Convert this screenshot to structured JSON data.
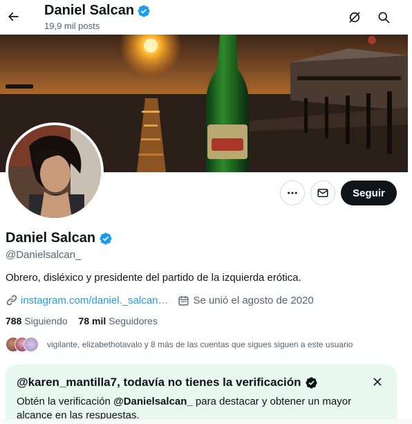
{
  "header": {
    "display_name": "Daniel Salcan",
    "posts_count": "19,9 mil posts"
  },
  "profile": {
    "display_name": "Daniel Salcan",
    "handle": "@Danielsalcan_",
    "bio": "Obrero, disléxico y presidente del partido de la izquierda erótica.",
    "link": "instagram.com/daniel._salcan…",
    "joined": "Se unió el agosto de 2020",
    "following_count": "788",
    "following_label": "Siguiendo",
    "followers_count": "78 mil",
    "followers_label": "Seguidores",
    "followers_you_know": "vigilante, elizabethotavalo y 8 más de las cuentas que sigues siguen a este usuario"
  },
  "actions": {
    "follow_label": "Seguir"
  },
  "verification_card": {
    "title": "@karen_mantilla7, todavía no tienes la verificación",
    "body_prefix": "Obtén la verificación ",
    "body_handle": "@Danielsalcan_",
    "body_suffix": " para destacar y obtener un mayor alcance en las respuestas."
  },
  "colors": {
    "accent": "#1d9bf0",
    "verified_badge": "#1d9bf0",
    "follow_button": "#0f1419",
    "card_background": "#e8f7ef",
    "secondary_text": "#536471"
  },
  "icons": {
    "back": "arrow-left-icon",
    "grok": "grok-icon",
    "search": "search-icon",
    "verified": "verified-badge-icon",
    "more": "more-dots-icon",
    "message": "envelope-icon",
    "link": "link-icon",
    "calendar": "calendar-icon",
    "close": "close-icon"
  }
}
